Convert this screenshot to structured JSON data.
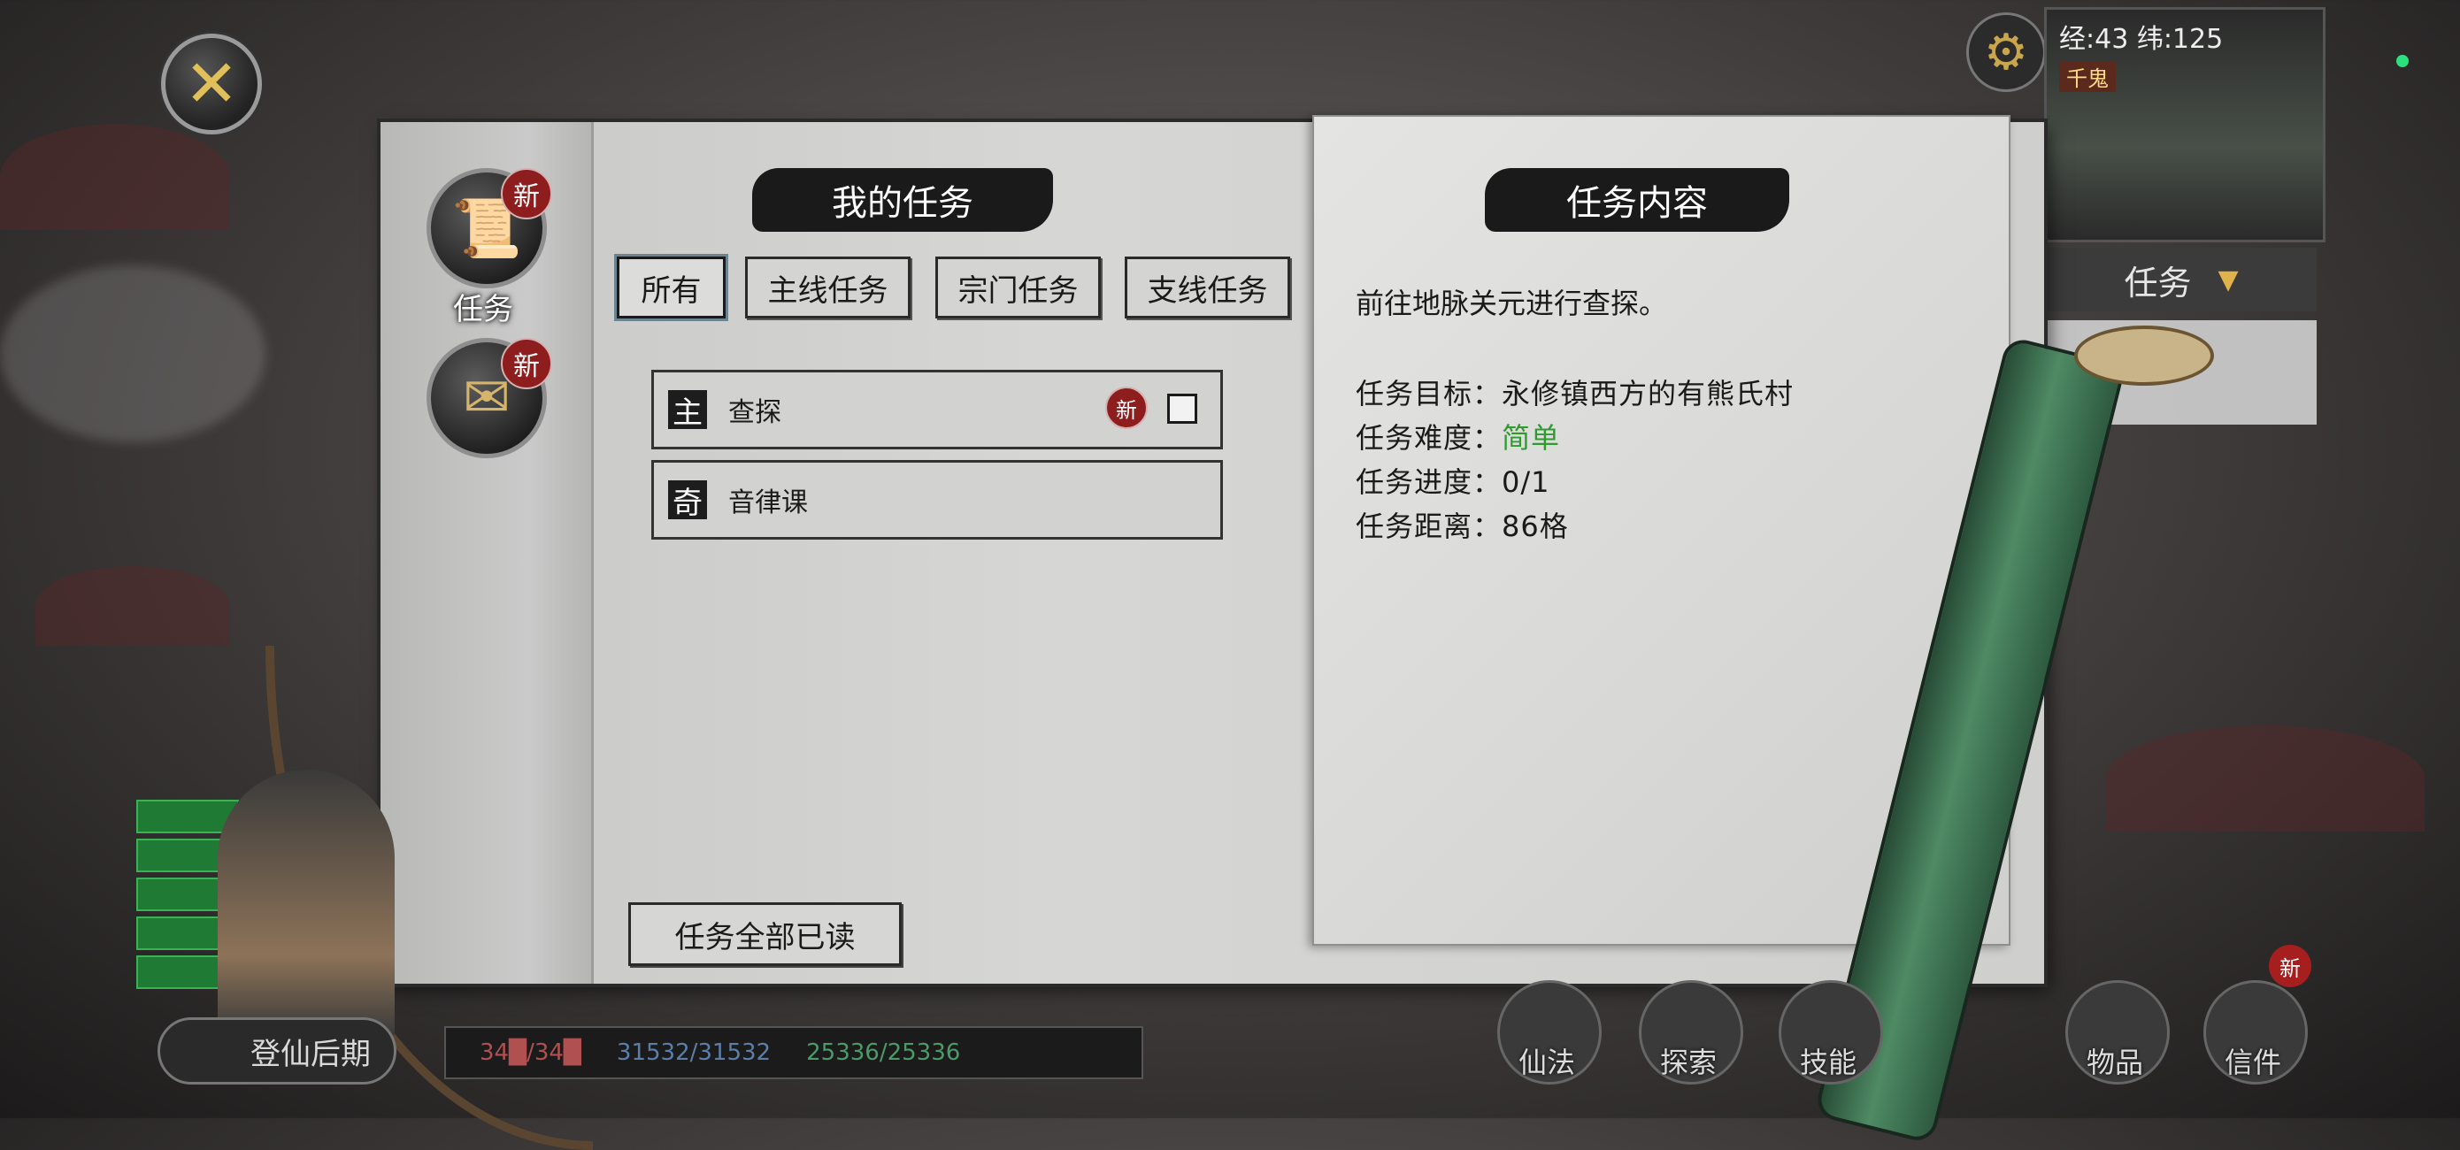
{
  "hud": {
    "minimap_status": "经:43 纬:125",
    "minimap_location": "千鬼",
    "mini_task_label": "任务",
    "realm_button": "登仙后期",
    "hp_text": "34█/34█",
    "mp_text": "31532/31532",
    "sp_text": "25336/25336",
    "dock": [
      "仙法",
      "探索",
      "技能",
      "物品",
      "信件"
    ],
    "dock_new": "新"
  },
  "sidebar": {
    "tabs": [
      {
        "label": "任务",
        "badge": "新",
        "icon": "scroll-icon"
      },
      {
        "label": "",
        "badge": "新",
        "icon": "letter-icon"
      }
    ]
  },
  "task_list": {
    "title": "我的任务",
    "filters": [
      "所有",
      "主线任务",
      "宗门任务",
      "支线任务"
    ],
    "active_filter": "所有",
    "rows": [
      {
        "type": "主",
        "name": "查探",
        "badge": "新",
        "has_checkbox": true
      },
      {
        "type": "奇",
        "name": "音律课",
        "badge": "",
        "has_checkbox": false
      }
    ],
    "read_all_label": "任务全部已读"
  },
  "task_detail": {
    "title": "任务内容",
    "description": "前往地脉关元进行查探。",
    "goal_label": "任务目标：",
    "goal": "永修镇西方的有熊氏村",
    "difficulty_label": "任务难度：",
    "difficulty": "简单",
    "progress_label": "任务进度：",
    "progress": "0/1",
    "distance_label": "任务距离：",
    "distance": "86格"
  },
  "colors": {
    "paper": "#d6d6d4",
    "ink": "#1a1a1a",
    "badge_red": "#8e1d1d",
    "difficulty_green": "#2f9a2f",
    "bamboo_green": "#4e8a64"
  }
}
